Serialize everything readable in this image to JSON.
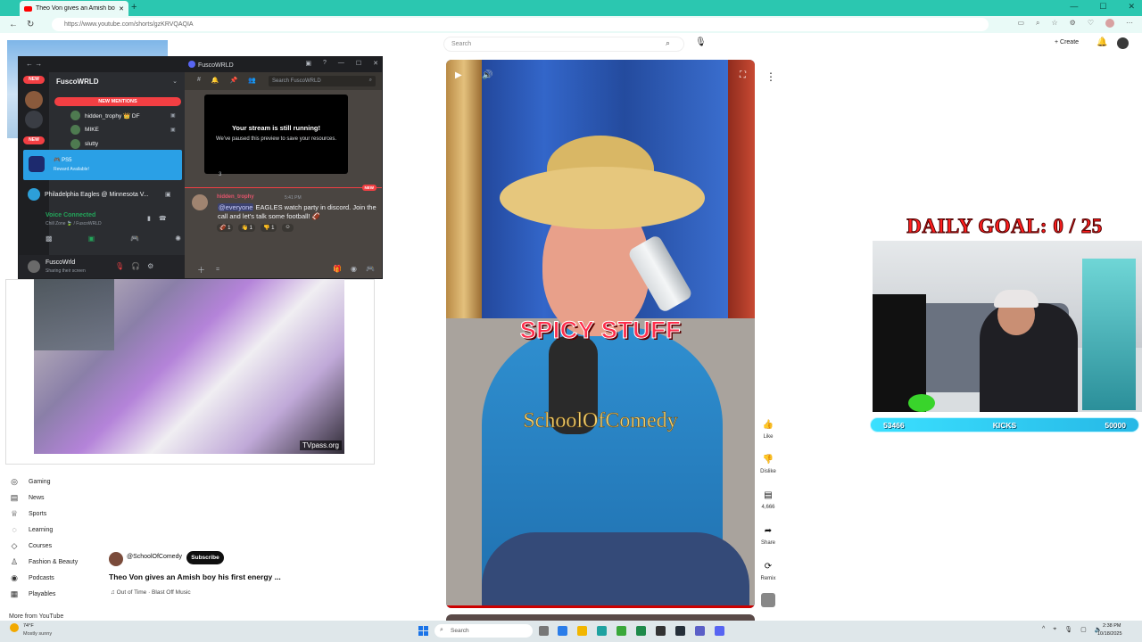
{
  "browser": {
    "tab_title": "Theo Von gives an Amish boy hi",
    "new_tab": "+",
    "url": "https://www.youtube.com/shorts/gzKRVQAQIA"
  },
  "youtube": {
    "search_placeholder": "Search",
    "create_label": "+ Create",
    "sidebar": [
      {
        "icon": "gaming-icon",
        "glyph": "◎",
        "label": "Gaming"
      },
      {
        "icon": "news-icon",
        "glyph": "▤",
        "label": "News"
      },
      {
        "icon": "sports-icon",
        "glyph": "♕",
        "label": "Sports"
      },
      {
        "icon": "learning-icon",
        "glyph": "◌",
        "label": "Learning"
      },
      {
        "icon": "courses-icon",
        "glyph": "◇",
        "label": "Courses"
      },
      {
        "icon": "fashion-icon",
        "glyph": "♙",
        "label": "Fashion & Beauty"
      },
      {
        "icon": "podcasts-icon",
        "glyph": "◉",
        "label": "Podcasts"
      },
      {
        "icon": "playables-icon",
        "glyph": "▦",
        "label": "Playables"
      }
    ],
    "more_from": "More from YouTube",
    "short": {
      "caption": "SPICY STUFF",
      "watermark": "SchoolOfComedy",
      "channel": "@SchoolOfComedy",
      "subscribe": "Subscribe",
      "title": "Theo Von gives an Amish boy his first energy ...",
      "music": "♫ Out of Time · Blast Off Music"
    },
    "actions": {
      "like": "Like",
      "dislike": "Dislike",
      "comments": "4,666",
      "share": "Share",
      "remix": "Remix"
    }
  },
  "discord": {
    "window_title": "FuscoWRLD",
    "server_name": "FuscoWRLD",
    "new_badge": "NEW",
    "new_mentions": "NEW MENTIONS",
    "users": [
      {
        "name": "hidden_trophy 👑 DF"
      },
      {
        "name": "MIKE"
      },
      {
        "name": "slutty"
      }
    ],
    "ps_title": "🎮 PS5",
    "ps_sub": "Reward Available!",
    "game": "Philadelphia Eagles @ Minnesota V...",
    "voice_connected": "Voice Connected",
    "voice_sub": "Chill Zone 🍃 / FuscoWRLD",
    "me_name": "FuscoWrld",
    "me_status": "Sharing their screen",
    "search_placeholder": "Search FuscoWRLD",
    "stream_title": "Your stream is still running!",
    "stream_body": "We've paused this preview to save your resources.",
    "stream_chip": "3",
    "new_tag": "NEW",
    "msg_author": "hidden_trophy",
    "msg_time": "5:41 PM",
    "msg_mention": "@everyone",
    "msg_text": " EAGLES watch party in discord. Join the call and let's talk some football! 🏈",
    "reactions": [
      "🏈 1",
      "👋 1",
      "👎 1",
      "☺"
    ]
  },
  "mini_player": {
    "watermark": "TVpass.org"
  },
  "stream_overlay": {
    "goal": "DAILY GOAL: 0 / 25",
    "kicks_left": "53466",
    "kicks_label": "KICKS",
    "kicks_right": "50000"
  },
  "taskbar": {
    "weather_temp": "74°F",
    "weather_desc": "Mostly sunny",
    "search": "Search",
    "time": "2:38 PM",
    "date": "10/18/2025"
  }
}
